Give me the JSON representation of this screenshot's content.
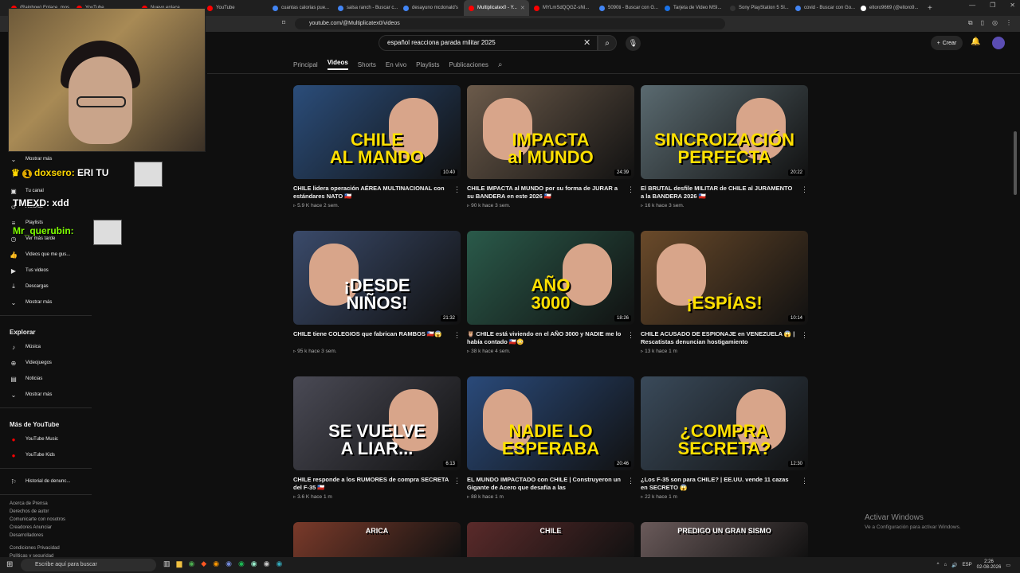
{
  "browser": {
    "tabs": [
      {
        "label": "(Rainbow) Enlace, mos...",
        "color": "#ff0000",
        "active": false
      },
      {
        "label": "YouTube",
        "color": "#ff0000",
        "active": false
      },
      {
        "label": "Nuevo enlace",
        "color": "#ff0000",
        "active": false
      },
      {
        "label": "YouTube",
        "color": "#ff0000",
        "active": false
      },
      {
        "label": "cuantas calorias pue...",
        "color": "#4285f4",
        "active": false
      },
      {
        "label": "salsa ranch - Buscar c...",
        "color": "#4285f4",
        "active": false
      },
      {
        "label": "desayuno mcdonald's",
        "color": "#4285f4",
        "active": false
      },
      {
        "label": "Multiplicatex0 - Y...",
        "color": "#ff0000",
        "active": true
      },
      {
        "label": "MYLmSdQQGZ-sNI...",
        "color": "#ff0000",
        "active": false
      },
      {
        "label": "5090ti - Buscar con G...",
        "color": "#4285f4",
        "active": false
      },
      {
        "label": "Tarjeta de Video MSI...",
        "color": "#1a73e8",
        "active": false
      },
      {
        "label": "Sony PlayStation 5 Sl...",
        "color": "#333333",
        "active": false
      },
      {
        "label": "covid - Buscar con Go...",
        "color": "#4285f4",
        "active": false
      },
      {
        "label": "eltoro9669 (@eltoro9...",
        "color": "#ffffff",
        "active": false
      }
    ],
    "url": "youtube.com/@Multiplicatex0/videos"
  },
  "header": {
    "search_value": "español reacciona parada militar 2025",
    "create_label": "Crear"
  },
  "channel_tabs": [
    "Principal",
    "Videos",
    "Shorts",
    "En vivo",
    "Playlists",
    "Publicaciones"
  ],
  "sidebar": {
    "top": [
      {
        "label": "Mostrar más",
        "icon": "chevron-down-icon",
        "glyph": "⌄"
      },
      {
        "label": "Tú",
        "icon": "person-icon",
        "glyph": "›"
      },
      {
        "label": "Tu canal",
        "icon": "channel-icon",
        "glyph": "▣"
      },
      {
        "label": "Historial",
        "icon": "history-icon",
        "glyph": "↺"
      },
      {
        "label": "Playlists",
        "icon": "playlist-icon",
        "glyph": "≡"
      },
      {
        "label": "Ver más tarde",
        "icon": "clock-icon",
        "glyph": "◷"
      },
      {
        "label": "Videos que me gus...",
        "icon": "like-icon",
        "glyph": "👍"
      },
      {
        "label": "Tus videos",
        "icon": "video-icon",
        "glyph": "▶"
      },
      {
        "label": "Descargas",
        "icon": "download-icon",
        "glyph": "⤓"
      },
      {
        "label": "Mostrar más",
        "icon": "chevron-down-icon",
        "glyph": "⌄"
      }
    ],
    "explore_title": "Explorar",
    "explore": [
      {
        "label": "Música",
        "icon": "music-icon",
        "glyph": "♪"
      },
      {
        "label": "Videojuegos",
        "icon": "gaming-icon",
        "glyph": "⊕"
      },
      {
        "label": "Noticias",
        "icon": "news-icon",
        "glyph": "▤"
      },
      {
        "label": "Mostrar más",
        "icon": "chevron-down-icon",
        "glyph": "⌄"
      }
    ],
    "more_title": "Más de YouTube",
    "more": [
      {
        "label": "YouTube Music",
        "icon": "youtube-music-icon",
        "glyph": "●"
      },
      {
        "label": "YouTube Kids",
        "icon": "youtube-kids-icon",
        "glyph": "●"
      }
    ],
    "report": {
      "label": "Historial de denunc...",
      "icon": "flag-icon",
      "glyph": "⚐"
    },
    "footer1": "Acerca de   Prensa\nDerechos de autor\nComunicarte con nosotros\nCreadores   Anunciar\nDesarrolladores",
    "footer2": "Condiciones   Privacidad\nPolíticas y seguridad"
  },
  "stream_overlay": {
    "chat": [
      {
        "user": "doxsero:",
        "text": "ERI TU",
        "badge": "1"
      },
      {
        "user": "TMEXD:",
        "text": "xdd"
      },
      {
        "user": "Mr_querubin:",
        "text": ""
      }
    ]
  },
  "videos": [
    {
      "thumb_text": "CHILE\nAL MANDO",
      "duration": "10:40",
      "title": "CHILE lidera operación AÉREA MULTINACIONAL con estándares NATO 🇨🇱",
      "views": "5.9 K",
      "age": "hace 2 sem.",
      "bg": "#2b4d7a"
    },
    {
      "thumb_text": "IMPACTA\nal MUNDO",
      "duration": "24:39",
      "title": "CHILE IMPACTA al MUNDO por su forma de JURAR a su BANDERA en este 2026 🇨🇱",
      "views": "90 k",
      "age": "hace 3 sem.",
      "bg": "#6b5a4a"
    },
    {
      "thumb_text": "SINCROIZACIÓN\nPERFECTA",
      "duration": "20:22",
      "title": "El BRUTAL desfile MILITAR de CHILE al JURAMENTO a la BANDERA 2026 🇨🇱",
      "views": "16 k",
      "age": "hace 3 sem.",
      "bg": "#5a6a70"
    },
    {
      "thumb_text": "¡DESDE\nNIÑOS!",
      "duration": "21:32",
      "title": "CHILE tiene COLEGIOS que fabrican RAMBOS 🇨🇱😱",
      "views": "95 k",
      "age": "hace 3 sem.",
      "bg": "#3a4a6a"
    },
    {
      "thumb_text": "AÑO\n3000",
      "duration": "18:26",
      "title": "🦉 CHILE está viviendo en el AÑO 3000 y NADIE me lo había contado 🇨🇱😳",
      "views": "38 k",
      "age": "hace 4 sem.",
      "bg": "#2a5a4a"
    },
    {
      "thumb_text": "¡ESPÍAS!",
      "duration": "10:14",
      "title": "CHILE ACUSADO DE ESPIONAJE en VENEZUELA 😱 | Rescatistas denuncian hostigamiento",
      "views": "13 k",
      "age": "hace 1 m",
      "bg": "#6a4a2a"
    },
    {
      "thumb_text": "SE VUELVE\nA LIAR...",
      "duration": "6:13",
      "title": "CHILE responde a los RUMORES de compra SECRETA del F-35 🇨🇱",
      "views": "3.6 K",
      "age": "hace 1 m",
      "bg": "#4a4a55"
    },
    {
      "thumb_text": "NADIE LO\nESPERABA",
      "duration": "20:46",
      "title": "EL MUNDO IMPACTADO con CHILE | Construyeron un Gigante de Acero que desafía a las SUPERPOTENCIA...",
      "views": "88 k",
      "age": "hace 1 m",
      "bg": "#2a4a7a"
    },
    {
      "thumb_text": "¿COMPRA\nSECRETA?",
      "duration": "12:30",
      "title": "¿Los F-35 son para CHILE? | EE.UU. vende 11 cazas en SECRETO 😱",
      "views": "22 k",
      "age": "hace 1 m",
      "bg": "#3a4a5a"
    }
  ],
  "next_row_thumbs": [
    {
      "thumb_text": "ARICA",
      "bg": "#7a3a2a"
    },
    {
      "thumb_text": "CHILE",
      "bg": "#5a2a2a"
    },
    {
      "thumb_text": "PREDIGO UN GRAN SISMO",
      "bg": "#6a5a5a"
    }
  ],
  "watermark": {
    "title": "Activar Windows",
    "subtitle": "Ve a Configuración para activar Windows."
  },
  "taskbar": {
    "search_placeholder": "Escribe aquí para buscar",
    "lang": "ESP",
    "time": "2:26",
    "date": "02-08-2026"
  }
}
